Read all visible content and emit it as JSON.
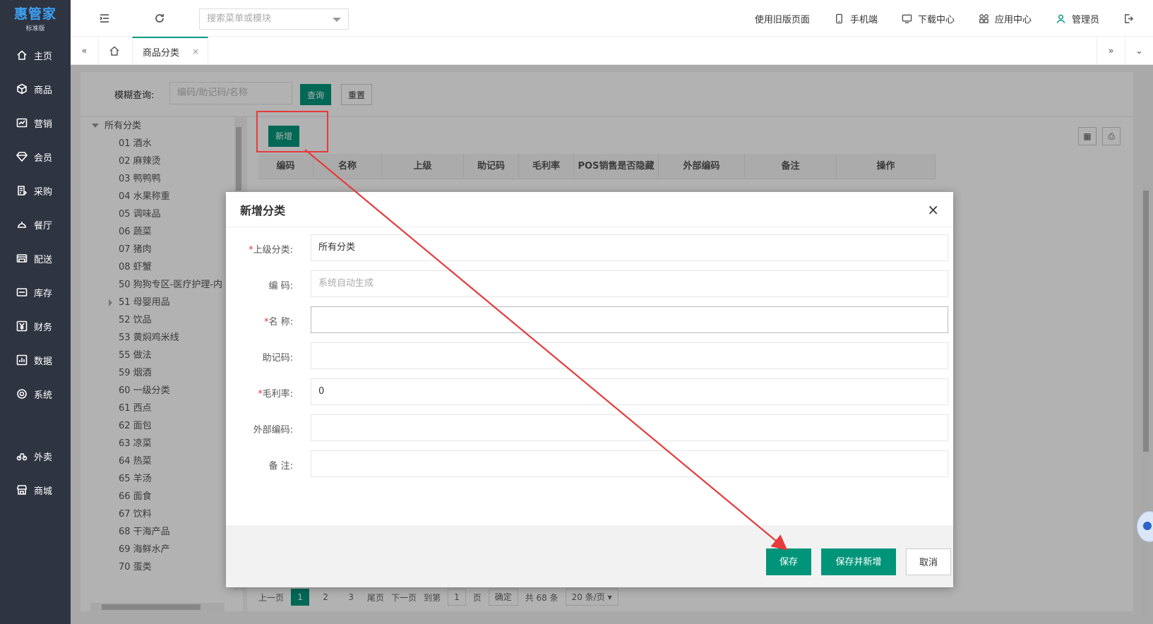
{
  "app": {
    "logo": "惠管家",
    "edition": "标准版"
  },
  "sidebar": {
    "items": [
      {
        "label": "主页",
        "icon": "home-icon"
      },
      {
        "label": "商品",
        "icon": "cube-icon"
      },
      {
        "label": "营销",
        "icon": "chart-icon"
      },
      {
        "label": "会员",
        "icon": "diamond-icon"
      },
      {
        "label": "采购",
        "icon": "clipboard-icon"
      },
      {
        "label": "餐厅",
        "icon": "dish-icon"
      },
      {
        "label": "配送",
        "icon": "truck-icon"
      },
      {
        "label": "库存",
        "icon": "box-icon"
      },
      {
        "label": "财务",
        "icon": "yen-icon"
      },
      {
        "label": "数据",
        "icon": "bar-chart-icon"
      },
      {
        "label": "系统",
        "icon": "settings-icon"
      }
    ],
    "extra": [
      {
        "label": "外卖",
        "icon": "bike-icon"
      },
      {
        "label": "商城",
        "icon": "store-icon"
      }
    ]
  },
  "topbar": {
    "search_placeholder": "搜索菜单或模块",
    "old_version": "使用旧版页面",
    "mobile": "手机端",
    "download": "下载中心",
    "apps": "应用中心",
    "user": "管理员"
  },
  "tabs": {
    "active": "商品分类",
    "close": "×"
  },
  "filter": {
    "label": "模糊查询:",
    "placeholder": "编码/助记码/名称",
    "search_btn": "查询",
    "reset_btn": "重置"
  },
  "tree": {
    "root": "所有分类",
    "items": [
      "01 酒水",
      "02 麻辣烫",
      "03 鸭鸭鸭",
      "04 水果称重",
      "05 调味品",
      "06 蔬菜",
      "07 猪肉",
      "08 虾蟹",
      "50 狗狗专区-医疗护理-内",
      "51 母婴用品",
      "52 饮品",
      "53 黄焖鸡米线",
      "55 做法",
      "59 烟酒",
      "60 一级分类",
      "61 西点",
      "62 面包",
      "63 凉菜",
      "64 热菜",
      "65 羊汤",
      "66 面食",
      "67 饮料",
      "68 干海产品",
      "69 海鲜水产",
      "70 蛋类"
    ]
  },
  "grid": {
    "add_btn": "新增",
    "columns": [
      "编码",
      "名称",
      "上级",
      "助记码",
      "毛利率",
      "POS销售是否隐藏",
      "外部编码",
      "备注",
      "操作"
    ]
  },
  "pager": {
    "prev": "上一页",
    "pages": [
      "1",
      "2",
      "3"
    ],
    "last": "尾页",
    "next": "下一页",
    "goto": "到第",
    "page_input": "1",
    "page_unit": "页",
    "confirm": "确定",
    "total": "共 68 条",
    "page_size": "20 条/页"
  },
  "dialog": {
    "title": "新增分类",
    "close": "×",
    "fields": [
      {
        "label": "上级分类:",
        "required": true,
        "value": "所有分类",
        "placeholder": ""
      },
      {
        "label": "编 码:",
        "required": false,
        "value": "",
        "placeholder": "系统自动生成"
      },
      {
        "label": "名 称:",
        "required": true,
        "value": "",
        "placeholder": ""
      },
      {
        "label": "助记码:",
        "required": false,
        "value": "",
        "placeholder": ""
      },
      {
        "label": "毛利率:",
        "required": true,
        "value": "0",
        "placeholder": ""
      },
      {
        "label": "外部编码:",
        "required": false,
        "value": "",
        "placeholder": ""
      },
      {
        "label": "备 注:",
        "required": false,
        "value": "",
        "placeholder": ""
      }
    ],
    "save": "保存",
    "save_and_new": "保存并新增",
    "cancel": "取消"
  },
  "colors": {
    "teal": "#00957a",
    "sidebar": "#2f3441",
    "annotation_red": "#e63b3b"
  }
}
